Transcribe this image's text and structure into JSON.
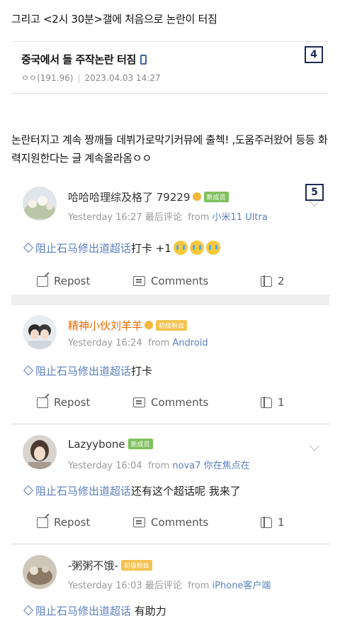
{
  "intro": "그리고 <2시 30분>갤에 처음으로 논란이 터짐",
  "post": {
    "title": "중국에서 돌 주작논란 터짐",
    "author": "ㅇㅇ(191.96)",
    "date": "2023.04.03 14:27",
    "badge": "4"
  },
  "body": "논란터지고 계속 짱깨들 데뷔가로막기커뮤에 출첵! ,도움주러왔어 등등 화력지원한다는 글 계속올라옴ㅇㅇ",
  "weibo": {
    "badge": "5",
    "topic": "阻止石马修出道超话",
    "actions": {
      "repost": "Repost",
      "comments": "Comments"
    },
    "posts": [
      {
        "username": "哈哈哈理综及格了 79229",
        "tag": "新成员",
        "time": "Yesterday 16:27",
        "extra": "最后评论",
        "from_label": "from",
        "source": "小米11 Ultra",
        "text": "打卡 +1",
        "likes": "2"
      },
      {
        "username": "精神小伙刘羊羊",
        "tag": "初级粉丝",
        "time": "Yesterday 16:24",
        "extra": "",
        "from_label": "from",
        "source": "Android",
        "text": "打卡",
        "likes": "1"
      },
      {
        "username": "Lazyybone",
        "tag": "新成员",
        "time": "Yesterday 16:04",
        "extra": "",
        "from_label": "from",
        "source": "nova7 你在焦点在",
        "text": "还有这个超话呢 我来了",
        "likes": "1"
      },
      {
        "username": "-粥粥不饿-",
        "tag": "初级粉丝",
        "time": "Yesterday 16:03",
        "extra": "最后评论",
        "from_label": "from",
        "source": "iPhone客户端",
        "text": " 有助力",
        "likes": ""
      }
    ]
  },
  "colors": {
    "link": "#5b7fbf",
    "accent_orange": "#e86b00",
    "tag_green": "#7ec05d",
    "tag_gold": "#f3c24f"
  }
}
